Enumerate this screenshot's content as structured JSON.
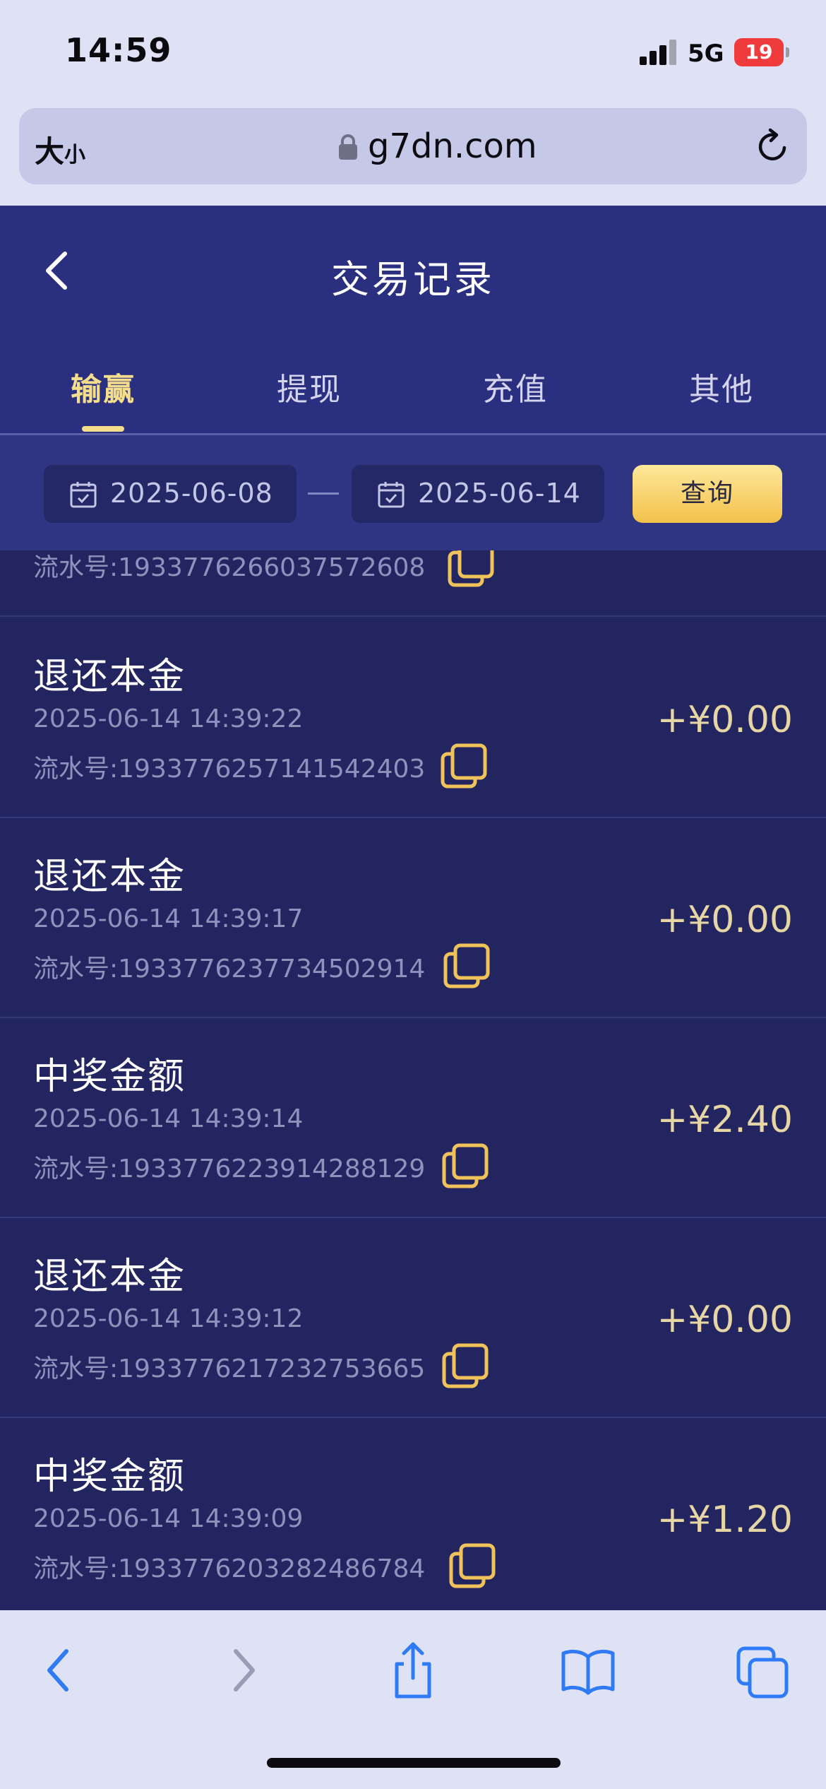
{
  "status_bar": {
    "time": "14:59",
    "network": "5G",
    "battery": "19"
  },
  "browser": {
    "text_size": "大",
    "text_size_small": "小",
    "url": "g7dn.com"
  },
  "header": {
    "title": "交易记录"
  },
  "tabs": [
    {
      "label": "输赢",
      "active": true
    },
    {
      "label": "提现",
      "active": false
    },
    {
      "label": "充值",
      "active": false
    },
    {
      "label": "其他",
      "active": false
    }
  ],
  "filter": {
    "start_date": "2025-06-08",
    "separator": "—",
    "end_date": "2025-06-14",
    "query_label": "查询"
  },
  "records": [
    {
      "type": "",
      "time": "",
      "serial": "流水号:1933776266037572608",
      "amount": ""
    },
    {
      "type": "退还本金",
      "time": "2025-06-14 14:39:22",
      "serial": "流水号:1933776257141542403",
      "amount": "+¥0.00"
    },
    {
      "type": "退还本金",
      "time": "2025-06-14 14:39:17",
      "serial": "流水号:1933776237734502914",
      "amount": "+¥0.00"
    },
    {
      "type": "中奖金额",
      "time": "2025-06-14 14:39:14",
      "serial": "流水号:1933776223914288129",
      "amount": "+¥2.40"
    },
    {
      "type": "退还本金",
      "time": "2025-06-14 14:39:12",
      "serial": "流水号:1933776217232753665",
      "amount": "+¥0.00"
    },
    {
      "type": "中奖金额",
      "time": "2025-06-14 14:39:09",
      "serial": "流水号:1933776203282486784",
      "amount": "+¥1.20"
    }
  ],
  "colors": {
    "header_bg": "#2b2f80",
    "list_bg": "#232561",
    "accent": "#f4dd8b",
    "amount": "#e6d6a6",
    "ios_blue": "#2f7bf6"
  }
}
